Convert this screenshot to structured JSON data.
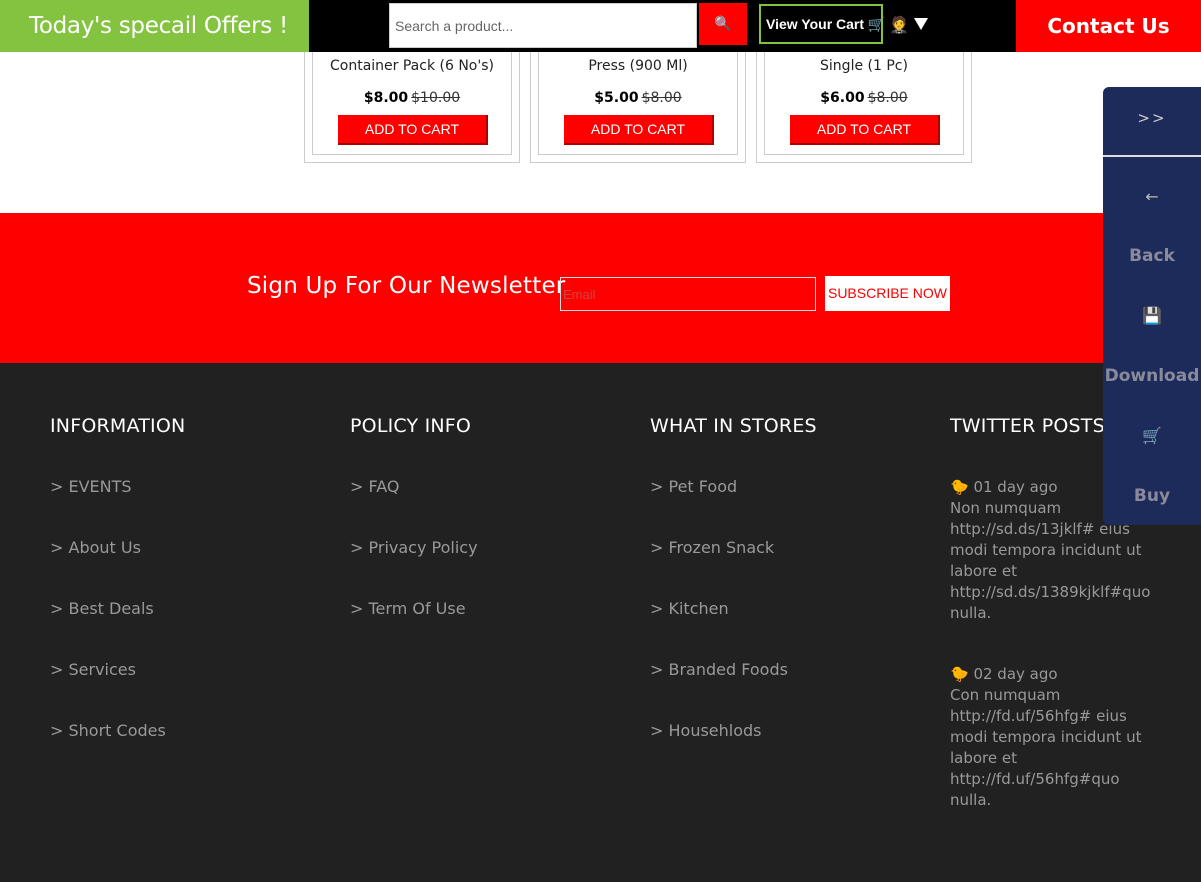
{
  "header": {
    "offers_text": "Today's specail Offers !",
    "search_placeholder": "Search a product...",
    "search_icon": "🔍",
    "cart_label": "View Your Cart 🛒",
    "user_icon": "🤵",
    "contact_label": "Contact Us"
  },
  "products": [
    {
      "name": "Container Pack (6 No's)",
      "price": "$8.00",
      "old_price": "$10.00",
      "button": "ADD TO CART"
    },
    {
      "name": "Press (900 Ml)",
      "price": "$5.00",
      "old_price": "$8.00",
      "button": "ADD TO CART"
    },
    {
      "name": "Single (1 Pc)",
      "price": "$6.00",
      "old_price": "$8.00",
      "button": "ADD TO CART"
    }
  ],
  "newsletter": {
    "title": "Sign Up For Our Newsletter",
    "email_placeholder": "Email",
    "button": "SUBSCRIBE NOW"
  },
  "footer": {
    "information": {
      "heading": "INFORMATION",
      "links": [
        "> EVENTS",
        "> About Us",
        "> Best Deals",
        "> Services",
        "> Short Codes"
      ]
    },
    "policy": {
      "heading": "POLICY INFO",
      "links": [
        "> FAQ",
        "> Privacy Policy",
        "> Term Of Use"
      ]
    },
    "stores": {
      "heading": "WHAT IN STORES",
      "links": [
        "> Pet Food",
        "> Frozen Snack",
        "> Kitchen",
        "> Branded Foods",
        "> Househlods"
      ]
    },
    "twitter": {
      "heading": "TWITTER POSTS",
      "posts": [
        {
          "date": "🐤 01 day ago",
          "text": "Non numquam http://sd.ds/13jklf# eius modi tempora incidunt ut labore et http://sd.ds/1389kjklf#quo nulla."
        },
        {
          "date": "🐤 02 day ago",
          "text": "Con numquam http://fd.uf/56hfg# eius modi tempora incidunt ut labore et http://fd.uf/56hfg#quo nulla."
        }
      ]
    }
  },
  "sidepanel": {
    "toggle": ">>",
    "back_icon": "←",
    "back_label": "Back",
    "download_icon": "💾",
    "download_label": "Download",
    "buy_icon": "🛒",
    "buy_label": "Buy"
  }
}
